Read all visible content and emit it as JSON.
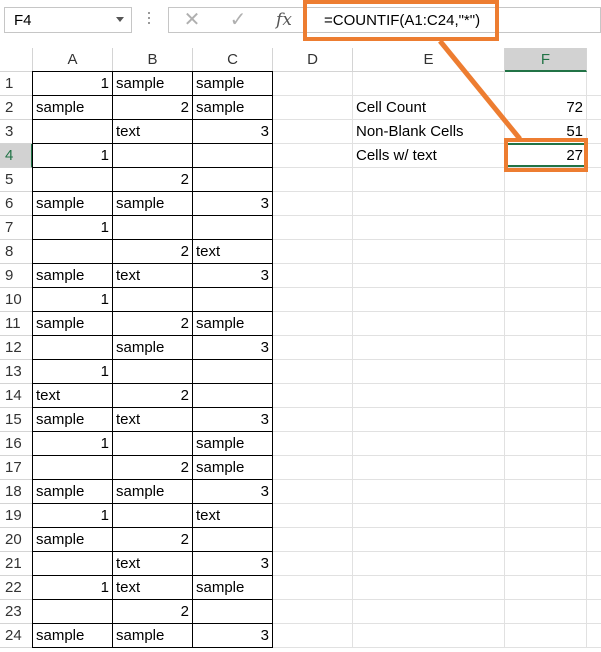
{
  "name_box": {
    "value": "F4"
  },
  "formula_bar": {
    "cancel_glyph": "✕",
    "enter_glyph": "✓",
    "fx_label": "fx",
    "formula": "=COUNTIF(A1:C24,\"*\")"
  },
  "columns": [
    "A",
    "B",
    "C",
    "D",
    "E",
    "F"
  ],
  "active_column": "F",
  "active_row": 4,
  "rows": [
    {
      "n": "1",
      "a": "1",
      "b": "sample",
      "c": "sample"
    },
    {
      "n": "2",
      "a": "sample",
      "b": "2",
      "c": "sample"
    },
    {
      "n": "3",
      "a": "",
      "b": "text",
      "c": "3"
    },
    {
      "n": "4",
      "a": "1",
      "b": "",
      "c": ""
    },
    {
      "n": "5",
      "a": "",
      "b": "2",
      "c": ""
    },
    {
      "n": "6",
      "a": "sample",
      "b": "sample",
      "c": "3"
    },
    {
      "n": "7",
      "a": "1",
      "b": "",
      "c": ""
    },
    {
      "n": "8",
      "a": "",
      "b": "2",
      "c": "text"
    },
    {
      "n": "9",
      "a": "sample",
      "b": "text",
      "c": "3"
    },
    {
      "n": "10",
      "a": "1",
      "b": "",
      "c": ""
    },
    {
      "n": "11",
      "a": "sample",
      "b": "2",
      "c": "sample"
    },
    {
      "n": "12",
      "a": "",
      "b": "sample",
      "c": "3"
    },
    {
      "n": "13",
      "a": "1",
      "b": "",
      "c": ""
    },
    {
      "n": "14",
      "a": "text",
      "b": "2",
      "c": ""
    },
    {
      "n": "15",
      "a": "sample",
      "b": "text",
      "c": "3"
    },
    {
      "n": "16",
      "a": "1",
      "b": "",
      "c": "sample"
    },
    {
      "n": "17",
      "a": "",
      "b": "2",
      "c": "sample"
    },
    {
      "n": "18",
      "a": "sample",
      "b": "sample",
      "c": "3"
    },
    {
      "n": "19",
      "a": "1",
      "b": "",
      "c": "text"
    },
    {
      "n": "20",
      "a": "sample",
      "b": "2",
      "c": ""
    },
    {
      "n": "21",
      "a": "",
      "b": "text",
      "c": "3"
    },
    {
      "n": "22",
      "a": "1",
      "b": "text",
      "c": "sample"
    },
    {
      "n": "23",
      "a": "",
      "b": "2",
      "c": ""
    },
    {
      "n": "24",
      "a": "sample",
      "b": "sample",
      "c": "3"
    }
  ],
  "summary": [
    {
      "row": "2",
      "label": "Cell  Count",
      "value": "72"
    },
    {
      "row": "3",
      "label": "Non-Blank Cells",
      "value": "51"
    },
    {
      "row": "4",
      "label": "Cells w/ text",
      "value": "27"
    }
  ],
  "colors": {
    "callout": "#ed7d31",
    "excel_green": "#217346",
    "header_active_bg": "#d2d2d2"
  }
}
